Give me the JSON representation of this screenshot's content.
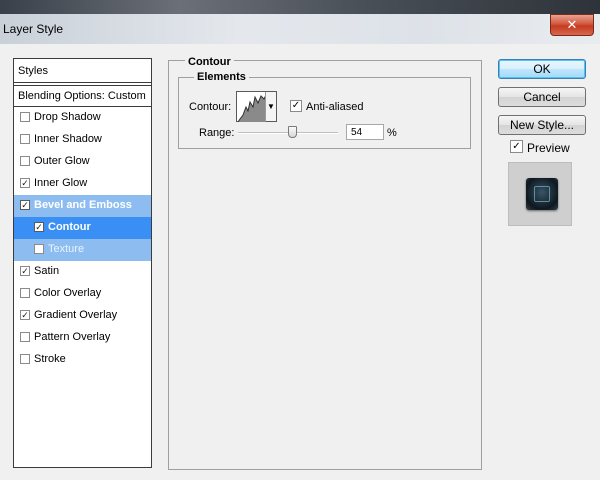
{
  "window": {
    "title": "Layer Style",
    "close_glyph": "✕"
  },
  "styles_list": {
    "header": "Styles",
    "blending": "Blending Options: Custom",
    "items": [
      {
        "label": "Drop Shadow",
        "checked": false
      },
      {
        "label": "Inner Shadow",
        "checked": false
      },
      {
        "label": "Outer Glow",
        "checked": false
      },
      {
        "label": "Inner Glow",
        "checked": true
      },
      {
        "label": "Bevel and Emboss",
        "checked": true
      },
      {
        "label": "Contour",
        "checked": true
      },
      {
        "label": "Texture",
        "checked": false
      },
      {
        "label": "Satin",
        "checked": true
      },
      {
        "label": "Color Overlay",
        "checked": false
      },
      {
        "label": "Gradient Overlay",
        "checked": true
      },
      {
        "label": "Pattern Overlay",
        "checked": false
      },
      {
        "label": "Stroke",
        "checked": false
      }
    ]
  },
  "panel": {
    "group_title": "Contour",
    "elements_title": "Elements",
    "contour_label": "Contour:",
    "antialiased_label": "Anti-aliased",
    "antialiased_checked": true,
    "range_label": "Range:",
    "range_value": "54",
    "range_unit": "%",
    "range_fraction": 0.54
  },
  "buttons": {
    "ok": "OK",
    "cancel": "Cancel",
    "new_style": "New Style...",
    "preview_label": "Preview",
    "preview_checked": true
  },
  "check_glyph": "✓",
  "colors": {
    "selection": "#3a8ff5",
    "selection_light": "#8dbdf0"
  }
}
